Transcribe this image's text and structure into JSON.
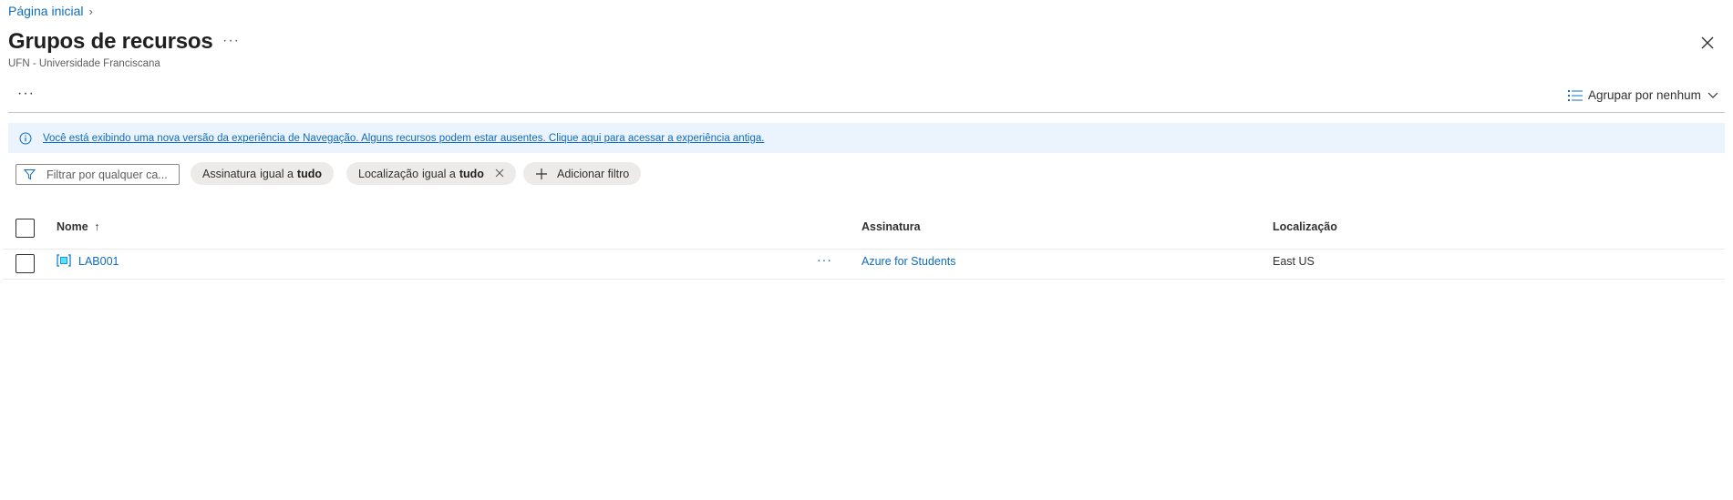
{
  "breadcrumb": {
    "home": "Página inicial",
    "separator": "›"
  },
  "header": {
    "title": "Grupos de recursos",
    "more": "···",
    "subtitle": "UFN - Universidade Franciscana",
    "close_icon": "close-icon"
  },
  "toolbar": {
    "more": "···",
    "groupby_label": "Agrupar por nenhum",
    "groupby_icon": "list-icon",
    "chevron_icon": "chevron-down-icon"
  },
  "banner": {
    "icon": "info-icon",
    "message": "Você está exibindo uma nova versão da experiência de Navegação. Alguns recursos podem estar ausentes. Clique aqui para acessar a experiência antiga.",
    "background": "#ebf3fc"
  },
  "filters": {
    "search_placeholder": "Filtrar por qualquer ca...",
    "search_value": "",
    "subscription_pill": {
      "field": "Assinatura",
      "op": "igual a",
      "value": "tudo"
    },
    "location_pill": {
      "field": "Localização",
      "op": "igual a",
      "value": "tudo"
    },
    "add_filter": "Adicionar filtro"
  },
  "table": {
    "columns": {
      "name": "Nome",
      "sort": "↑",
      "subscription": "Assinatura",
      "location": "Localização"
    },
    "rows": [
      {
        "name": "LAB001",
        "more": "···",
        "subscription": "Azure for Students",
        "location": "East US"
      }
    ]
  },
  "colors": {
    "accent": "#0f6cbd",
    "text": "#323130",
    "border": "#c8c6c4"
  }
}
